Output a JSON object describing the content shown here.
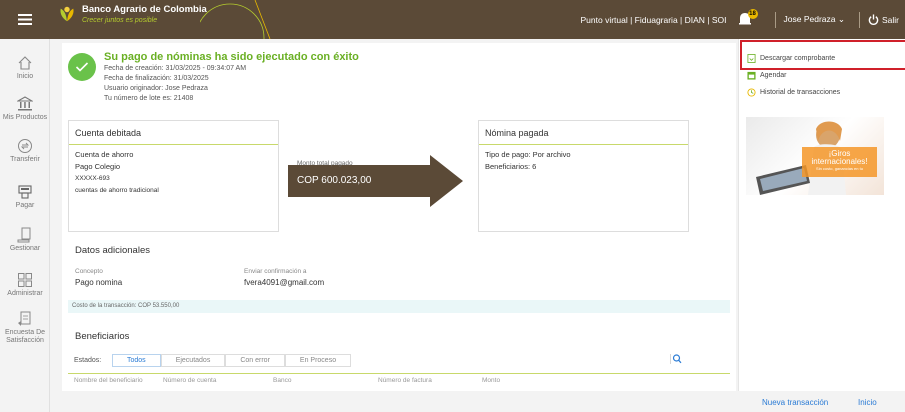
{
  "header": {
    "brand_name": "Banco Agrario de Colombia",
    "brand_slogan": "Crecer juntos es posible",
    "links": "Punto virtual | Fiduagraria | DIAN | SOI",
    "notification_count": "18",
    "user_name": "Jose Pedraza",
    "logout_label": "Salir"
  },
  "sidebar": {
    "items": [
      {
        "label": "Inicio",
        "icon": "home-icon"
      },
      {
        "label": "Mis Productos",
        "icon": "bank-icon"
      },
      {
        "label": "Transferir",
        "icon": "transfer-icon"
      },
      {
        "label": "Pagar",
        "icon": "pay-icon"
      },
      {
        "label": "Gestionar",
        "icon": "manage-icon"
      },
      {
        "label": "Administrar",
        "icon": "admin-icon"
      },
      {
        "label": "Encuesta De Satisfacción",
        "icon": "survey-icon"
      }
    ]
  },
  "success": {
    "title": "Su pago de nóminas ha sido ejecutado con éxito",
    "created": "Fecha de creación: 31/03/2025 - 09:34:07 AM",
    "finished": "Fecha de finalización: 31/03/2025",
    "originator": "Usuario originador: Jose Pedraza",
    "batch": "Tu número de lote es: 21408"
  },
  "debit_card": {
    "title": "Cuenta debitada",
    "account_type": "Cuenta de ahorro",
    "name": "Pago Colegio",
    "number": "XXXXX-693",
    "description": "cuentas de ahorro tradicional"
  },
  "transfer": {
    "label": "Monto total pagado",
    "amount": "COP 600.023,00"
  },
  "payroll_card": {
    "title": "Nómina pagada",
    "payment_type": "Tipo de pago: Por archivo",
    "beneficiaries": "Beneficiarios: 6"
  },
  "additional": {
    "title": "Datos adicionales",
    "concept_label": "Concepto",
    "concept_value": "Pago nomina",
    "confirm_label": "Enviar confirmación a",
    "confirm_value": "fvera4091@gmail.com",
    "cost": "Costo de la transacción: COP 53.550,00"
  },
  "beneficiaries": {
    "title": "Beneficiarios",
    "estados_label": "Estados:",
    "tabs": [
      "Todos",
      "Ejecutados",
      "Con error",
      "En Proceso"
    ],
    "columns": [
      "Nombre del beneficiario",
      "Número de cuenta",
      "Banco",
      "Número de factura",
      "Monto"
    ]
  },
  "right_panel": {
    "download": "Descargar comprobante",
    "schedule": "Agendar",
    "history": "Historial de transacciones",
    "promo_title_1": "¡Giros",
    "promo_title_2": "internacionales!",
    "promo_sub": "Sin costo, ganancias en tu"
  },
  "footer": {
    "new_transaction": "Nueva transacción",
    "home": "Inicio"
  },
  "colors": {
    "header_bg": "#5b4a37",
    "accent_green": "#6ab024",
    "link_blue": "#2a7bd5",
    "highlight_red": "#d0202a"
  }
}
